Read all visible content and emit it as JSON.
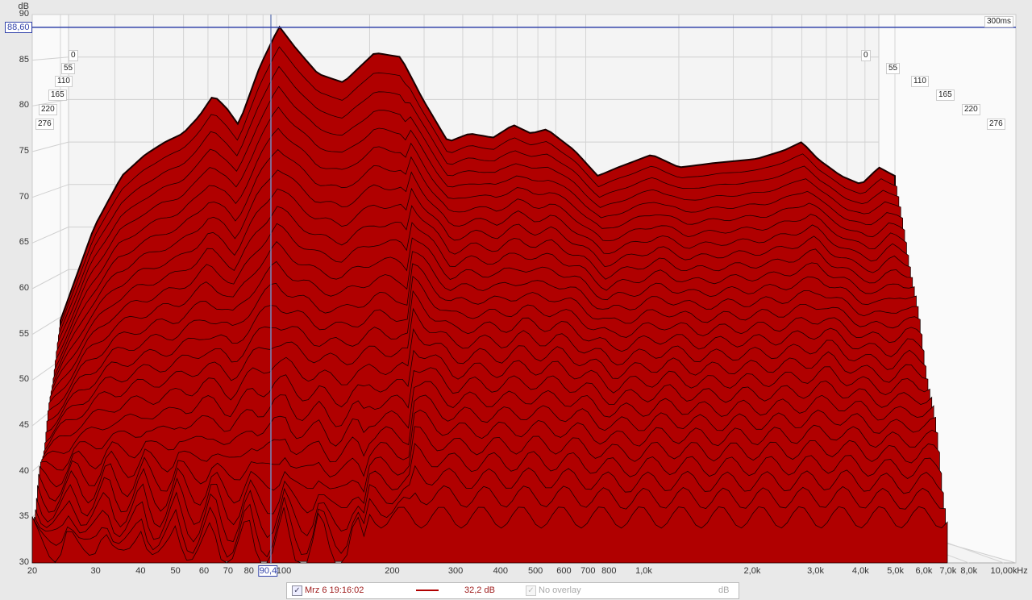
{
  "chart_data": {
    "type": "waterfall",
    "ylabel": "dB",
    "xlabel": "Hz",
    "ylim": [
      30,
      90
    ],
    "xlim": [
      20,
      10000
    ],
    "yticks": [
      "90",
      "85",
      "80",
      "75",
      "70",
      "65",
      "60",
      "55",
      "50",
      "45",
      "40",
      "35",
      "30"
    ],
    "xticks": [
      "20",
      "30",
      "40",
      "50",
      "60",
      "70",
      "80",
      "90,4",
      "100",
      "200",
      "300",
      "400",
      "500",
      "600",
      "700",
      "800",
      "1,0k",
      "2,0k",
      "3,0k",
      "4,0k",
      "5,0k",
      "6,0k",
      "7,0k",
      "8,0k",
      "10,00k",
      "Hz"
    ],
    "time_labels_ms": [
      "0",
      "55",
      "110",
      "165",
      "220",
      "276"
    ],
    "time_span_label": "300ms",
    "cursor": {
      "freq_label": "90,4",
      "db_label": "88,60"
    },
    "slice_count": 28,
    "floor_db": 35,
    "series_top": {
      "freq": [
        20,
        25,
        30,
        35,
        40,
        45,
        50,
        55,
        60,
        65,
        75,
        85,
        95,
        110,
        130,
        160,
        190,
        220,
        260,
        300,
        350,
        400,
        450,
        500,
        600,
        700,
        800,
        1000,
        1200,
        1500,
        2000,
        2400,
        2700,
        3000,
        3500,
        4000,
        4500,
        5000,
        6000,
        7000
      ],
      "db": [
        54,
        65,
        71,
        73.5,
        75,
        76,
        78,
        80.5,
        79,
        77,
        84,
        88.6,
        86,
        83,
        82,
        85.5,
        85,
        80,
        75,
        76,
        75.5,
        77,
        76,
        76.5,
        74,
        71,
        72,
        73.5,
        72,
        72.5,
        73,
        74,
        75,
        73,
        71,
        70,
        72,
        71,
        70,
        68
      ]
    },
    "fill_color": "#b00000",
    "line_color": "#1a0000"
  },
  "legend": {
    "series_name": "Mrz 6 19:16:02",
    "value": "32,2 dB",
    "overlay": "No overlay",
    "unit": "dB",
    "series_color": "#b00000"
  }
}
